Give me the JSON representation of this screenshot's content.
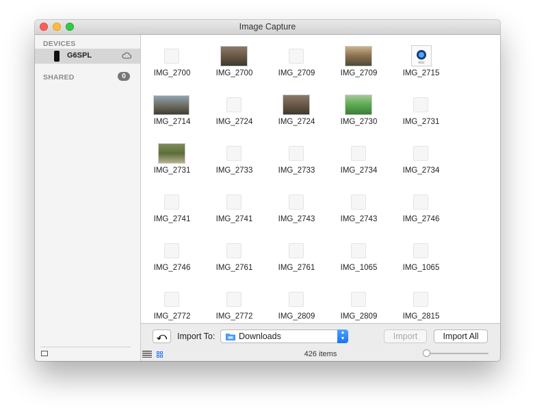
{
  "window": {
    "title": "Image Capture"
  },
  "sidebar": {
    "devices_header": "DEVICES",
    "device_name": "G6SPL",
    "shared_header": "SHARED",
    "shared_count": "0"
  },
  "grid": {
    "items": [
      {
        "label": "IMG_2700",
        "thumb": "blank"
      },
      {
        "label": "IMG_2700",
        "thumb": "photo-people"
      },
      {
        "label": "IMG_2709",
        "thumb": "blank"
      },
      {
        "label": "IMG_2709",
        "thumb": "photo-outdoor"
      },
      {
        "label": "IMG_2715",
        "thumb": "mov-document"
      },
      {
        "label": "IMG_2714",
        "thumb": "photo-wide"
      },
      {
        "label": "IMG_2724",
        "thumb": "blank"
      },
      {
        "label": "IMG_2724",
        "thumb": "photo-people"
      },
      {
        "label": "IMG_2730",
        "thumb": "photo-green"
      },
      {
        "label": "IMG_2731",
        "thumb": "blank"
      },
      {
        "label": "IMG_2731",
        "thumb": "photo-forest"
      },
      {
        "label": "IMG_2733",
        "thumb": "blank"
      },
      {
        "label": "IMG_2733",
        "thumb": "blank"
      },
      {
        "label": "IMG_2734",
        "thumb": "blank"
      },
      {
        "label": "IMG_2734",
        "thumb": "blank"
      },
      {
        "label": "IMG_2741",
        "thumb": "blank"
      },
      {
        "label": "IMG_2741",
        "thumb": "blank"
      },
      {
        "label": "IMG_2743",
        "thumb": "blank"
      },
      {
        "label": "IMG_2743",
        "thumb": "blank"
      },
      {
        "label": "IMG_2746",
        "thumb": "blank"
      },
      {
        "label": "IMG_2746",
        "thumb": "blank"
      },
      {
        "label": "IMG_2761",
        "thumb": "blank"
      },
      {
        "label": "IMG_2761",
        "thumb": "blank"
      },
      {
        "label": "IMG_1065",
        "thumb": "blank"
      },
      {
        "label": "IMG_1065",
        "thumb": "blank"
      },
      {
        "label": "IMG_2772",
        "thumb": "blank"
      },
      {
        "label": "IMG_2772",
        "thumb": "blank"
      },
      {
        "label": "IMG_2809",
        "thumb": "blank"
      },
      {
        "label": "IMG_2809",
        "thumb": "blank"
      },
      {
        "label": "IMG_2815",
        "thumb": "blank"
      }
    ]
  },
  "toolbar": {
    "rotate_label": "⤺",
    "import_to_label": "Import To:",
    "destination": "Downloads",
    "import_label": "Import",
    "import_all_label": "Import All",
    "item_count": "426 items",
    "thumbnail_size_fraction": 0.0
  },
  "icons": {
    "close": "close-icon",
    "minimize": "minimize-icon",
    "maximize": "maximize-icon",
    "phone": "phone-icon",
    "cloud": "cloud-icon",
    "folder": "folder-icon",
    "list_view": "list-view-icon",
    "grid_view": "grid-view-icon"
  },
  "colors": {
    "accent": "#1b73f2",
    "close": "#fc605c",
    "minimize": "#fdbc40",
    "maximize": "#34c84a"
  }
}
